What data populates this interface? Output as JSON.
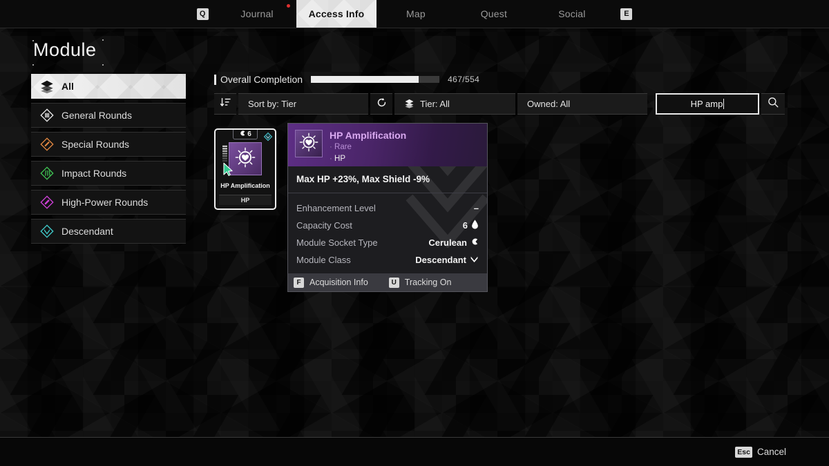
{
  "nav": {
    "left_key": "Q",
    "right_key": "E",
    "tabs": [
      {
        "label": "Journal",
        "active": false,
        "notify": true
      },
      {
        "label": "Access Info",
        "active": true,
        "notify": false
      },
      {
        "label": "Map",
        "active": false,
        "notify": false
      },
      {
        "label": "Quest",
        "active": false,
        "notify": false
      },
      {
        "label": "Social",
        "active": false,
        "notify": false
      }
    ]
  },
  "page": {
    "title": "Module"
  },
  "sidebar": {
    "items": [
      {
        "label": "All",
        "icon": "layers-icon",
        "color": "#1a1a1a",
        "active": true
      },
      {
        "label": "General Rounds",
        "icon": "general-rounds-icon",
        "color": "#e8e8e8",
        "active": false
      },
      {
        "label": "Special Rounds",
        "icon": "special-rounds-icon",
        "color": "#e08640",
        "active": false
      },
      {
        "label": "Impact Rounds",
        "icon": "impact-rounds-icon",
        "color": "#3fbf52",
        "active": false
      },
      {
        "label": "High-Power Rounds",
        "icon": "high-power-rounds-icon",
        "color": "#cc3fd6",
        "active": false
      },
      {
        "label": "Descendant",
        "icon": "descendant-icon",
        "color": "#3fc8c8",
        "active": false
      }
    ]
  },
  "completion": {
    "label": "Overall Completion",
    "count_text": "467/554",
    "current": 467,
    "total": 554,
    "percent": 84
  },
  "filters": {
    "sort_icon": "sort-descending-icon",
    "sort": "Sort by: Tier",
    "reset_icon": "reset-icon",
    "tier_icon": "layers-icon",
    "tier": "Tier: All",
    "owned": "Owned: All",
    "search_value": "HP amp",
    "search_icon": "search-icon"
  },
  "module_card": {
    "tier_icon": "capacity-icon",
    "tier_value": "6",
    "socket_icon": "cerulean-socket-icon",
    "name": "HP Amplification",
    "footer_label": "HP",
    "art_icon": "heart-burst-icon",
    "cursor_icon": "pointer-cursor-icon"
  },
  "tooltip": {
    "icon": "heart-burst-icon",
    "title": "HP Amplification",
    "rarity": "Rare",
    "category": "HP",
    "effect": "Max HP +23%, Max Shield -9%",
    "stats": [
      {
        "key": "Enhancement Level",
        "value": "–",
        "icon": ""
      },
      {
        "key": "Capacity Cost",
        "value": "6",
        "icon": "capacity-drop-icon"
      },
      {
        "key": "Module Socket Type",
        "value": "Cerulean",
        "icon": "cerulean-socket-icon"
      },
      {
        "key": "Module Class",
        "value": "Descendant",
        "icon": "descendant-chevron-icon"
      }
    ],
    "hints": [
      {
        "key": "F",
        "label": "Acquisition Info"
      },
      {
        "key": "U",
        "label": "Tracking On"
      }
    ]
  },
  "footer": {
    "key": "Esc",
    "label": "Cancel"
  },
  "colors": {
    "accent_purple": "#d9a9f0",
    "header_purple": "#5d2e85",
    "notify_red": "#e03030",
    "bar_fill": "#ededed"
  }
}
